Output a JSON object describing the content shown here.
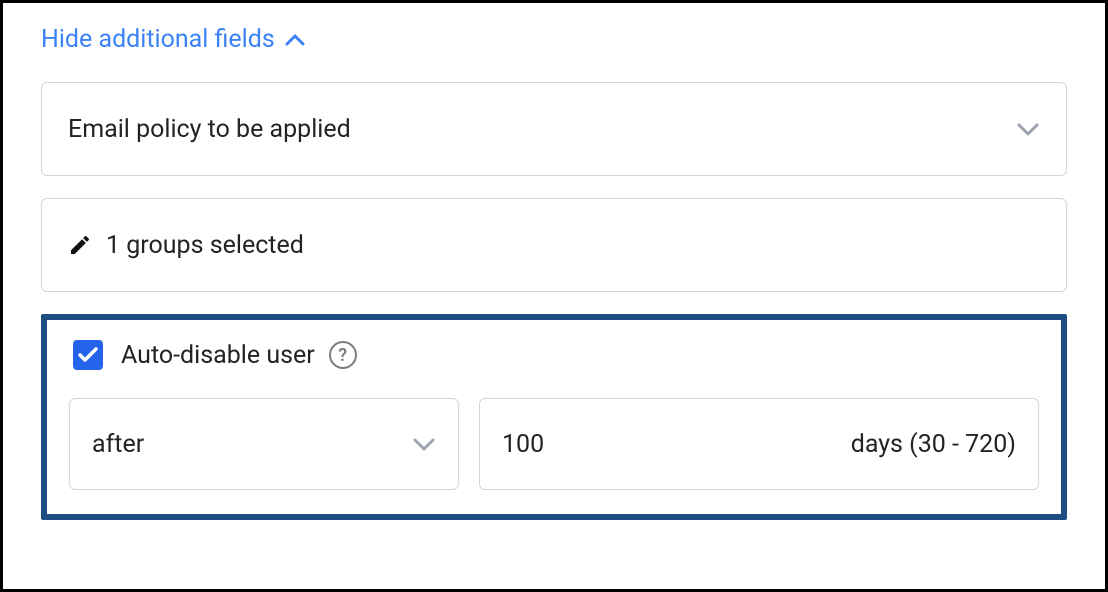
{
  "toggle": {
    "label": "Hide additional fields"
  },
  "emailPolicy": {
    "placeholder": "Email policy to be applied"
  },
  "groups": {
    "text": "1 groups selected"
  },
  "autoDisable": {
    "checked": true,
    "label": "Auto-disable user",
    "timing": {
      "selected": "after"
    },
    "days": {
      "value": "100",
      "suffix": "days (30 - 720)"
    }
  }
}
